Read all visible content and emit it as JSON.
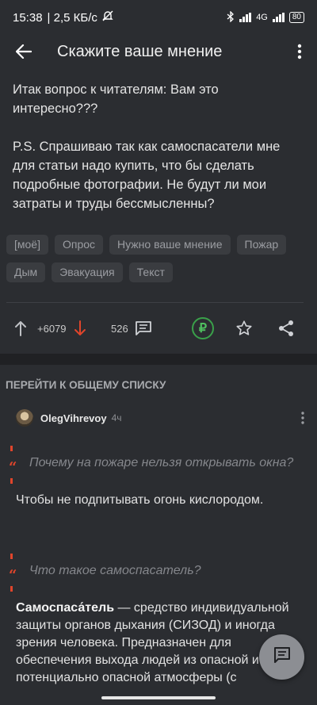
{
  "status_bar": {
    "time": "15:38",
    "network_speed": "| 2,5 КБ/с",
    "network_type": "4G",
    "battery": "80"
  },
  "app_bar": {
    "title": "Скажите ваше мнение"
  },
  "post": {
    "paragraph1": "Итак вопрос к читателям: Вам это интересно???",
    "paragraph2": "P.S. Спрашиваю так как самоспасатели мне для статьи надо купить, что бы сделать подробные фотографии. Не будут ли мои затраты и труды бессмысленны?",
    "tags": [
      "[моё]",
      "Опрос",
      "Нужно ваше мнение",
      "Пожар",
      "Дым",
      "Эвакуация",
      "Текст"
    ]
  },
  "actions": {
    "rating": "+6079",
    "comments_count": "526",
    "donate_symbol": "₽"
  },
  "comments_section": {
    "go_to_list": "ПЕРЕЙТИ К ОБЩЕМУ СПИСКУ"
  },
  "comment": {
    "author": "OlegVihrevoy",
    "time": "4ч",
    "quote1": "Почему на пожаре нельзя открывать окна?",
    "answer1": "Чтобы не подпитывать огонь кислородом.",
    "quote2": "Что такое самоспасатель?",
    "answer2_term": "Самоспаса́тель",
    "answer2_text": " — средство индивидуальной защиты органов дыхания (СИЗОД) и иногда зрения человека. Предназначен для обеспечения выхода людей из опасной и потенциально опасной атмосферы (с"
  },
  "colors": {
    "background": "#2b2d31",
    "accent_red": "#e0452b",
    "donate_green": "#3aa04a"
  },
  "icons": [
    "back-arrow-icon",
    "more-vert-icon",
    "upvote-icon",
    "downvote-icon",
    "comments-icon",
    "ruble-icon",
    "star-icon",
    "share-icon",
    "compose-icon"
  ]
}
